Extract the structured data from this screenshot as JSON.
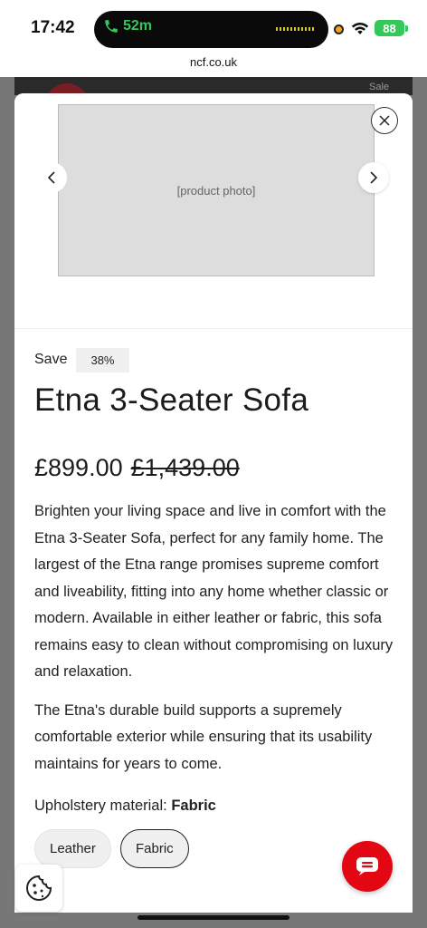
{
  "status_bar": {
    "time": "17:42",
    "call_duration": "52m",
    "battery": "88"
  },
  "browser": {
    "url": "ncf.co.uk"
  },
  "backdrop": {
    "sale_label": "Sale"
  },
  "product": {
    "save_label": "Save",
    "save_percent": "38%",
    "title": "Etna 3-Seater Sofa",
    "price_now": "£899.00",
    "price_was": "£1,439.00",
    "description": [
      "Brighten your living space and live in comfort with the Etna 3-Seater Sofa, perfect for any family home. The largest of the Etna range promises supreme comfort and liveability, fitting into any home whether classic or modern. Available in either leather or fabric, this sofa remains easy to clean without compromising on luxury and relaxation.",
      "The Etna's durable build supports a supremely comfortable exterior while ensuring that its usability maintains for years to come."
    ],
    "material_label": "Upholstery material:",
    "material_value": "Fabric",
    "options": [
      {
        "label": "Leather",
        "selected": false
      },
      {
        "label": "Fabric",
        "selected": true
      }
    ]
  },
  "colors": {
    "accent_red": "#e30613",
    "call_green": "#35c759"
  },
  "icons": [
    "phone-icon",
    "wifi-icon",
    "close-icon",
    "chevron-left-icon",
    "chevron-right-icon",
    "cookie-icon",
    "chat-icon"
  ]
}
